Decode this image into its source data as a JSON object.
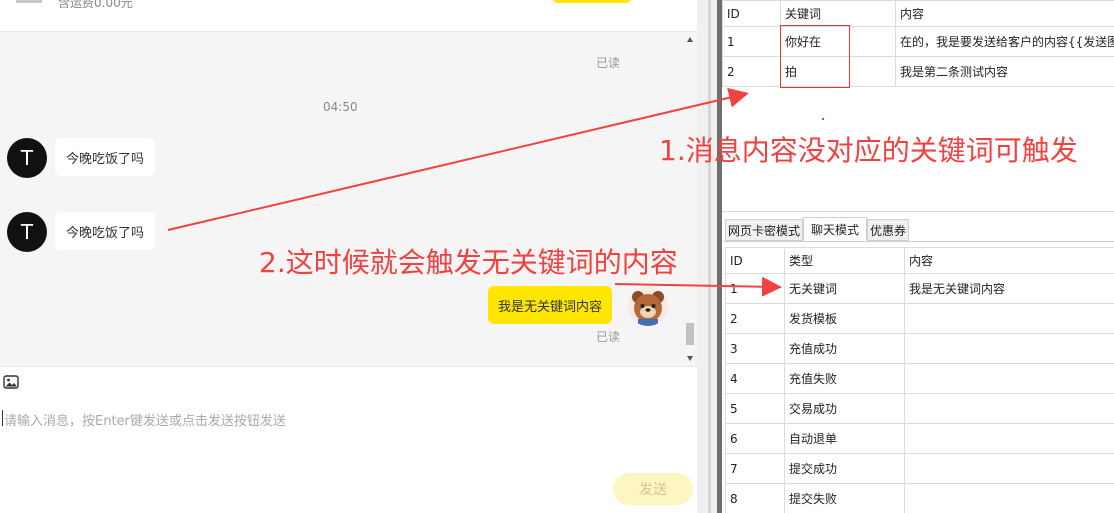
{
  "chat": {
    "header": {
      "fee_text": "含运费0.00元"
    },
    "messages": {
      "read_1": "已读",
      "time": "04:50",
      "msg_1": "今晚吃饭了吗",
      "msg_2": "今晚吃饭了吗",
      "avatar_letter": "T",
      "reply": "我是无关键词内容",
      "read_2": "已读"
    },
    "input": {
      "placeholder": "请输入消息，按Enter键发送或点击发送按钮发送",
      "send_label": "发送"
    }
  },
  "keyword_table": {
    "headers": [
      "ID",
      "关键词",
      "内容"
    ],
    "rows": [
      [
        "1",
        "你好在",
        "在的，我是要发送给客户的内容{{发送图"
      ],
      [
        "2",
        "拍",
        "我是第二条测试内容"
      ]
    ]
  },
  "tabs": [
    "网页卡密模式",
    "聊天模式",
    "优惠券"
  ],
  "active_tab": "聊天模式",
  "type_table": {
    "headers": [
      "ID",
      "类型",
      "内容"
    ],
    "rows": [
      [
        "1",
        "无关键词",
        "我是无关键词内容"
      ],
      [
        "2",
        "发货模板",
        ""
      ],
      [
        "3",
        "充值成功",
        ""
      ],
      [
        "4",
        "充值失败",
        ""
      ],
      [
        "5",
        "交易成功",
        ""
      ],
      [
        "6",
        "自动退单",
        ""
      ],
      [
        "7",
        "提交成功",
        ""
      ],
      [
        "8",
        "提交失败",
        ""
      ]
    ]
  },
  "annotations": {
    "note_1": "1.消息内容没对应的关键词可触发",
    "note_2": "2.这时候就会触发无关键词的内容"
  },
  "colors": {
    "accent_yellow": "#ffe600",
    "annotation_red": "#f24141"
  },
  "icons": [
    "image-icon",
    "scroll-up-icon",
    "scroll-down-icon",
    "bear-avatar-icon"
  ]
}
